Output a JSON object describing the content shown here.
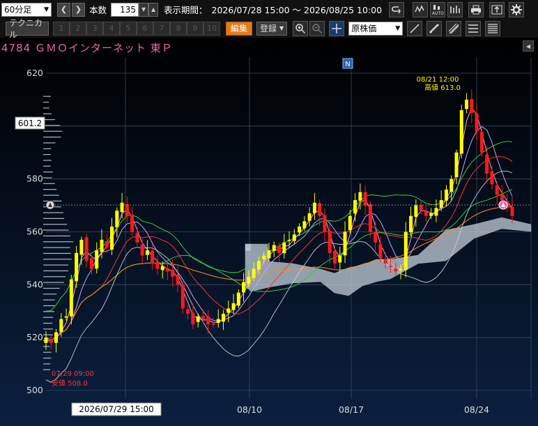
{
  "toolbar": {
    "interval": "60分足",
    "bars_label": "本数",
    "bars_value": "135",
    "period_label": "表示期間：",
    "period_value": "2026/07/28 15:00 ～ 2026/08/25 10:00",
    "technical_label": "テクニカル",
    "slots": [
      "1",
      "2",
      "3",
      "4",
      "5",
      "6",
      "7",
      "8",
      "9",
      "10"
    ],
    "edit_label": "編集",
    "register_label": "登録",
    "price_type": "原株価",
    "icons": [
      "prev-icon",
      "next-icon",
      "undo-icon",
      "candle-style-icon",
      "auto-icon",
      "bar-style-icon",
      "print-icon",
      "export-icon",
      "gear-icon",
      "zoom-in-icon",
      "zoom-out-icon",
      "crosshair-icon",
      "trendline-icon",
      "ruler-icon",
      "parallel-lines-icon",
      "horizontal-lines-icon",
      "fibonacci-icon"
    ]
  },
  "chart_header": {
    "title": "4784 ＧＭＯインターネット 東Ｐ",
    "news_marker": "N"
  },
  "chart_data": {
    "type": "candlestick",
    "ylim": [
      500,
      625
    ],
    "y_ticks": [
      500,
      520,
      540,
      560,
      580,
      600,
      620
    ],
    "x_tick_labels": [
      "08/10",
      "08/17",
      "08/24"
    ],
    "cursor_date_label": "2026/07/29 15:00",
    "current_price_label": "601.2",
    "high_annotation": {
      "date": "08/21 12:00",
      "label": "高値 613.0",
      "value": 613.0
    },
    "low_annotation": {
      "date": "07/29 09:00",
      "label": "安値 508.0",
      "value": 508.0
    },
    "close_path": [
      520,
      518,
      522,
      527,
      528,
      542,
      552,
      557,
      549,
      546,
      553,
      557,
      554,
      562,
      568,
      571,
      566,
      560,
      556,
      551,
      553,
      548,
      546,
      547,
      545,
      543,
      540,
      531,
      529,
      525,
      528,
      527,
      525,
      525,
      527,
      529,
      531,
      533,
      537,
      541,
      543,
      546,
      549,
      551,
      553,
      555,
      552,
      556,
      557,
      559,
      562,
      564,
      567,
      571,
      566,
      560,
      552,
      548,
      551,
      560,
      566,
      572,
      575,
      570,
      560,
      556,
      550,
      548,
      547,
      545,
      546,
      560,
      566,
      570,
      568,
      566,
      567,
      569,
      572,
      576,
      580,
      590,
      606,
      610,
      605,
      598,
      590,
      582,
      578,
      574,
      572,
      569,
      566
    ]
  },
  "colors": {
    "bg_top": "#000000",
    "bg_bottom": "#0b2040",
    "up": "#ffff00",
    "down": "#ff1a1a",
    "title": "#e86aa8",
    "edit_button": "#e07a1a",
    "high_text": "#ffff00",
    "low_text": "#ff3333"
  }
}
